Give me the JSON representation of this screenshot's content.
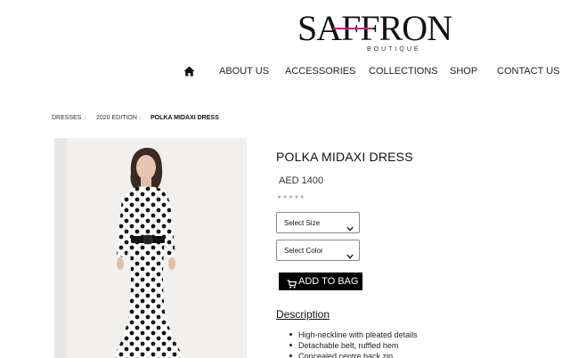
{
  "brand": {
    "name": "SAFFRON",
    "tagline": "BOUTIQUE",
    "accent_color": "#c0267a"
  },
  "nav": {
    "home_icon": "home-icon",
    "items": [
      "ABOUT US",
      "ACCESSORIES",
      "COLLECTIONS",
      "SHOP",
      "CONTACT US"
    ]
  },
  "breadcrumb": {
    "items": [
      "DRESSES",
      "2020 EDITION"
    ],
    "current": "POLKA MIDAXI DRESS"
  },
  "product": {
    "title": "POLKA MIDAXI DRESS",
    "price": "AED 1400",
    "rating_stars": "★★★★★",
    "size_select": {
      "selected": "Select Size"
    },
    "color_select": {
      "selected": "Select Color"
    },
    "add_to_bag_label": "ADD TO BAG",
    "description_heading": "Description",
    "description_items": [
      "High-neckline with pleated details",
      "Detachable belt, ruffled hem",
      "Concealed centre back zip"
    ]
  }
}
